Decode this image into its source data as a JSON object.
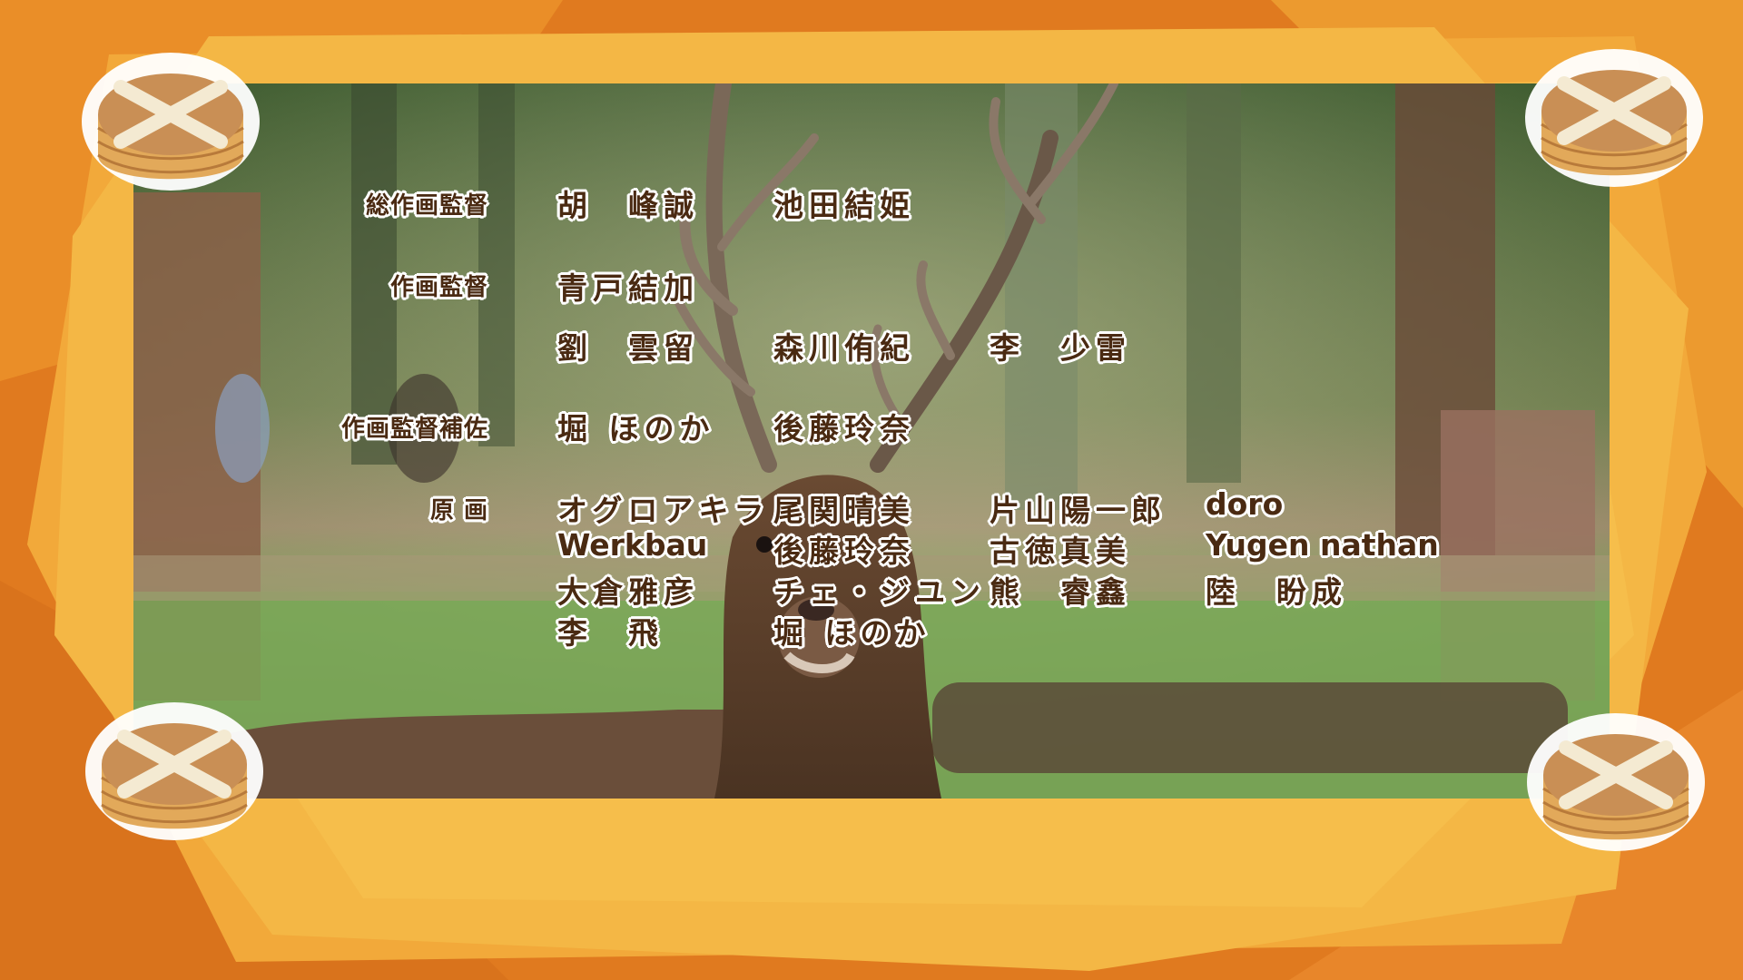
{
  "credits": {
    "sou_sakuga_kantoku": {
      "role": "総作画監督",
      "names": [
        "胡　峰誠",
        "池田結姫"
      ]
    },
    "sakuga_kantoku": {
      "role": "作画監督",
      "names": [
        "青戸結加",
        "劉　雲留",
        "森川侑紀",
        "李　少雷"
      ]
    },
    "sakuga_kantoku_hosa": {
      "role": "作画監督補佐",
      "names": [
        "堀 ほのか",
        "後藤玲奈"
      ]
    },
    "genga": {
      "role": "原 画",
      "names": [
        "オグロアキラ",
        "尾関晴美",
        "片山陽一郎",
        "doro",
        "Werkbau",
        "後藤玲奈",
        "古徳真美",
        "Yugen nathan",
        "大倉雅彦",
        "チェ・ジユン",
        "熊　睿鑫",
        "陸　盼成",
        "李　飛",
        "堀 ほのか"
      ]
    }
  },
  "colors": {
    "background_orange": "#e8922a",
    "frame_yellow": "#f2b73c",
    "text_brown": "#4a2a12"
  },
  "icons": [
    "cake-icon-top-left",
    "cake-icon-top-right",
    "cake-icon-bottom-left",
    "cake-icon-bottom-right"
  ]
}
